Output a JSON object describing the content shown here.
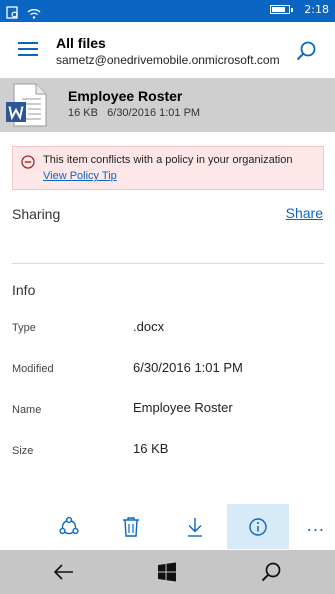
{
  "status_bar": {
    "time": "2:18",
    "icons": [
      "notification-icon",
      "wifi-icon",
      "battery-icon"
    ],
    "battery_level": 0.8
  },
  "header": {
    "title": "All files",
    "account": "sametz@onedrivemobile.onmicrosoft.com",
    "icons": [
      "hamburger-menu-icon",
      "search-icon"
    ]
  },
  "file": {
    "name": "Employee Roster",
    "size": "16 KB",
    "modified": "6/30/2016 1:01 PM",
    "icon": "word-document-icon"
  },
  "policy": {
    "message": "This item conflicts with a policy in your organization",
    "link": "View Policy Tip",
    "icon": "minus-circle-icon"
  },
  "sharing": {
    "label": "Sharing",
    "action": "Share"
  },
  "info": {
    "label": "Info",
    "rows": [
      {
        "label": "Type",
        "value": ".docx"
      },
      {
        "label": "Modified",
        "value": "6/30/2016 1:01 PM"
      },
      {
        "label": "Name",
        "value": "Employee Roster"
      },
      {
        "label": "Size",
        "value": "16 KB"
      }
    ]
  },
  "app_bar": {
    "buttons": [
      "share-icon",
      "delete-icon",
      "download-icon",
      "info-icon"
    ],
    "active": "info-icon",
    "more": "..."
  },
  "nav_bar": {
    "buttons": [
      "back-icon",
      "windows-start-icon",
      "search-icon"
    ]
  },
  "colors": {
    "accent": "#0a66c2",
    "banner": "#cfcfcf",
    "policy_bg": "#fde7e9",
    "policy_icon": "#a4262c",
    "active_btn": "#d6eaf8",
    "nav_bar": "#c6c6c6"
  }
}
